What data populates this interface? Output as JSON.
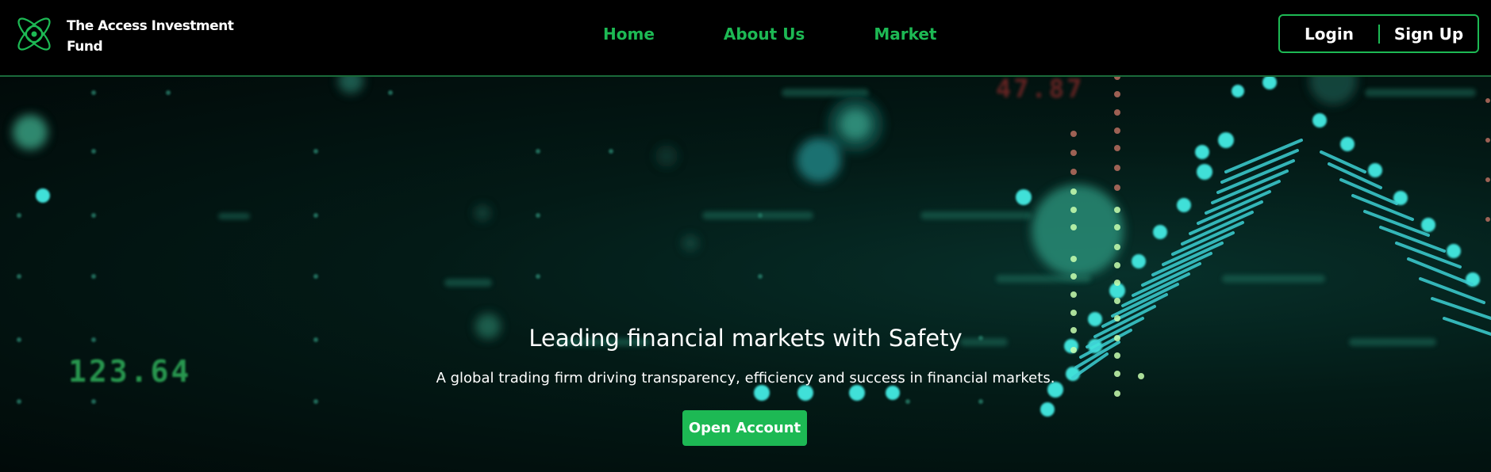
{
  "brand": {
    "name": "The Access Investment Fund",
    "logo_icon": "atom-icon"
  },
  "nav": {
    "items": [
      {
        "label": "Home"
      },
      {
        "label": "About Us"
      },
      {
        "label": "Market"
      }
    ]
  },
  "auth": {
    "login_label": "Login",
    "signup_label": "Sign Up"
  },
  "hero": {
    "title": "Leading financial markets with Safety",
    "subtitle": "A global trading firm driving transparency, efficiency and success in financial markets.",
    "cta_label": "Open Account",
    "readout_bottom_left": "123.64",
    "readout_top": "47.87"
  },
  "colors": {
    "accent": "#1db954",
    "background": "#000000",
    "hero_glow": "#3fd9c8",
    "readout_green": "#2fae5a",
    "readout_red": "#8a2a2a"
  }
}
